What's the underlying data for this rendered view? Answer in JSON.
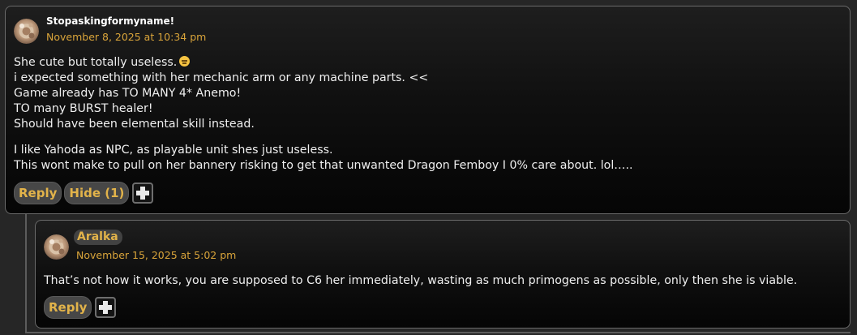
{
  "comments": [
    {
      "author": "Stopaskingformyname!",
      "date": "November 8, 2025 at 10:34 pm",
      "paragraphs": [
        [
          "She cute but totally useless.",
          "i expected something with her mechanic arm or any machine parts. <<",
          "Game already has TO MANY 4* Anemo!",
          "TO many BURST healer!",
          "Should have been elemental skill instead."
        ],
        [
          "I like Yahoda as NPC, as playable unit shes just useless.",
          "This wont make to pull on her bannery risking to get that unwanted Dragon Femboy I 0% care about. lol….."
        ]
      ],
      "emoji": "expressionless-face-emoji",
      "actions": {
        "reply": "Reply",
        "hide": "Hide (1)"
      }
    },
    {
      "author": "Aralka",
      "date": "November 15, 2025 at 5:02 pm",
      "paragraphs": [
        [
          "That’s not how it works, you are supposed to C6 her immediately, wasting as much primogens as possible, only then she is viable."
        ]
      ],
      "actions": {
        "reply": "Reply"
      }
    }
  ],
  "icons": {
    "avatar": "avatar-icon",
    "more": "plus-icon"
  },
  "colors": {
    "accent": "#e2b34a",
    "date": "#d9a43a",
    "background": "#262626",
    "pill": "#474747"
  }
}
